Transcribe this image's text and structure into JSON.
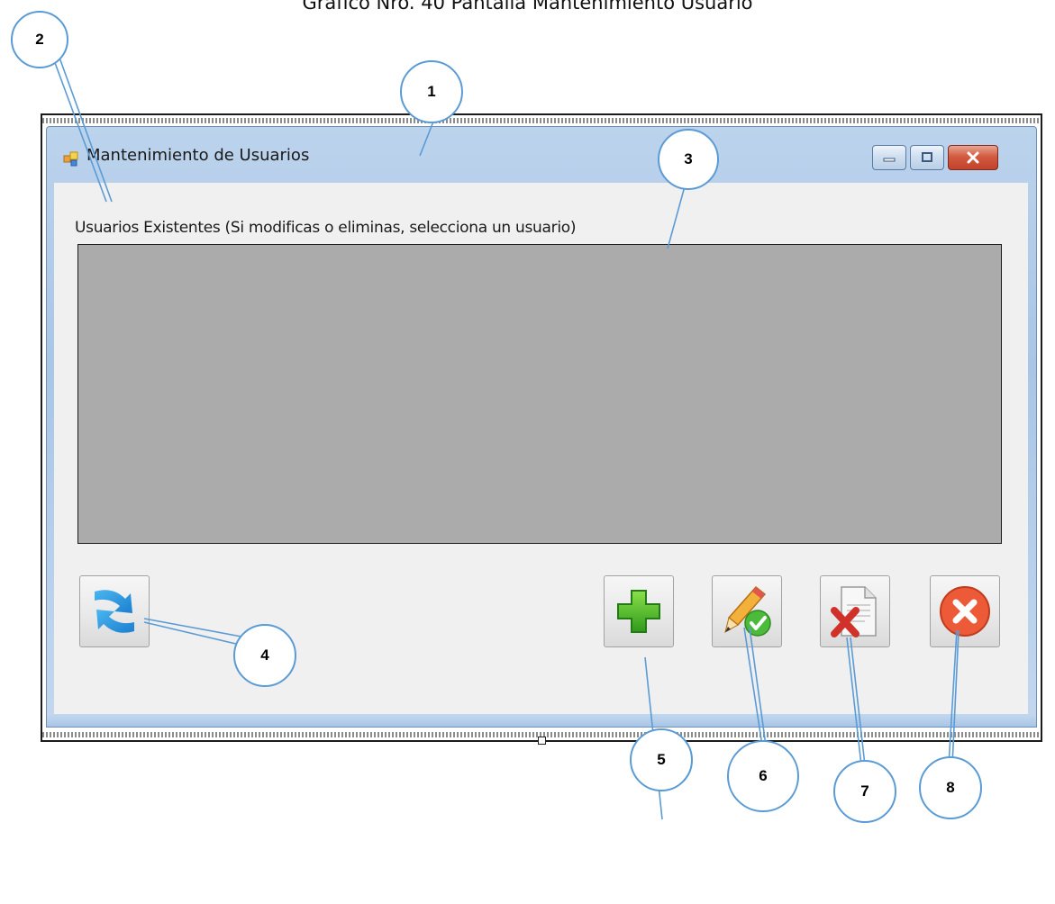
{
  "caption": "Gráfico Nro. 40 Pantalla Mantenimiento Usuario",
  "window": {
    "title": "Mantenimiento de Usuarios",
    "controls": [
      "minimize-icon",
      "maximize-icon",
      "close-icon"
    ]
  },
  "users_label": "Usuarios Existentes (Si modificas o eliminas, selecciona un usuario)",
  "buttons": [
    {
      "name": "refresh",
      "icon": "refresh-icon"
    },
    {
      "name": "add",
      "icon": "plus-icon"
    },
    {
      "name": "edit",
      "icon": "pencil-check-icon"
    },
    {
      "name": "delete",
      "icon": "document-delete-icon"
    },
    {
      "name": "exit",
      "icon": "circle-x-icon"
    }
  ],
  "callouts": [
    "1",
    "2",
    "3",
    "4",
    "5",
    "6",
    "7",
    "8"
  ],
  "colors": {
    "callout_border": "#5b9bd5",
    "grid_background": "#ababab",
    "titlebar": "#bcd3ec",
    "close_button": "#c94c33"
  }
}
